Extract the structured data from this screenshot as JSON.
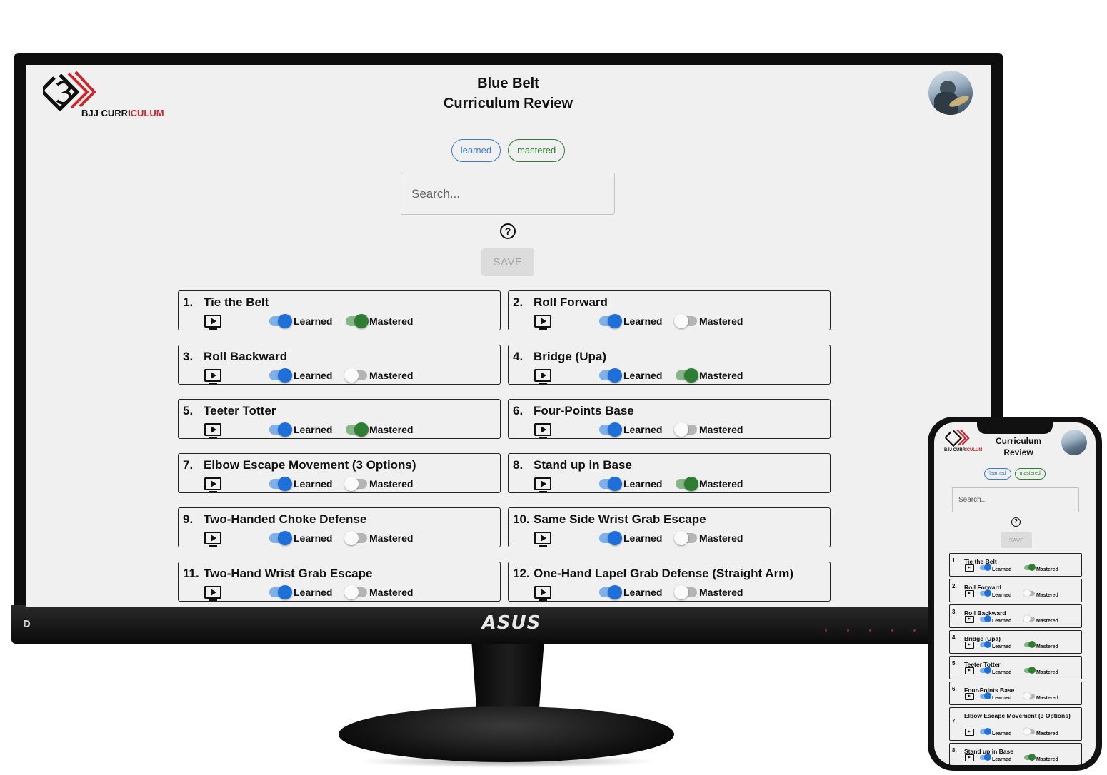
{
  "app": {
    "logo_text_dark": "BJJ CURRI",
    "logo_text_red": "CULUM",
    "title_line1": "Blue Belt",
    "title_line2": "Curriculum Review",
    "avatar_icon": "user-avatar-photo"
  },
  "filters": {
    "learned_label": "learned",
    "mastered_label": "mastered"
  },
  "search": {
    "placeholder": "Search..."
  },
  "help_glyph": "?",
  "save_label": "SAVE",
  "toggle_labels": {
    "learned": "Learned",
    "mastered": "Mastered"
  },
  "colors": {
    "learned_blue": "#1f6fd8",
    "mastered_green": "#2e7d32",
    "brand_red": "#c8282d"
  },
  "techniques": [
    {
      "num": "1.",
      "title": "Tie the Belt",
      "learned": true,
      "mastered": true
    },
    {
      "num": "2.",
      "title": "Roll Forward",
      "learned": true,
      "mastered": false
    },
    {
      "num": "3.",
      "title": "Roll Backward",
      "learned": true,
      "mastered": false
    },
    {
      "num": "4.",
      "title": "Bridge (Upa)",
      "learned": true,
      "mastered": true
    },
    {
      "num": "5.",
      "title": "Teeter Totter",
      "learned": true,
      "mastered": true
    },
    {
      "num": "6.",
      "title": "Four-Points Base",
      "learned": true,
      "mastered": false
    },
    {
      "num": "7.",
      "title": "Elbow Escape Movement (3 Options)",
      "learned": true,
      "mastered": false
    },
    {
      "num": "8.",
      "title": "Stand up in Base",
      "learned": true,
      "mastered": true
    },
    {
      "num": "9.",
      "title": "Two-Handed Choke Defense",
      "learned": true,
      "mastered": false
    },
    {
      "num": "10.",
      "title": "Same Side Wrist Grab Escape",
      "learned": true,
      "mastered": false
    },
    {
      "num": "11.",
      "title": "Two-Hand Wrist Grab Escape",
      "learned": true,
      "mastered": false
    },
    {
      "num": "12.",
      "title": "One-Hand Lapel Grab Defense (Straight Arm)",
      "learned": true,
      "mastered": false
    }
  ],
  "mobile": {
    "title_line1": "Curriculum",
    "title_line2": "Review",
    "techniques": [
      {
        "num": "1.",
        "title": "Tie the Belt",
        "mastered": true
      },
      {
        "num": "2.",
        "title": "Roll Forward",
        "mastered": false
      },
      {
        "num": "3.",
        "title": "Roll Backward",
        "mastered": false
      },
      {
        "num": "4.",
        "title": "Bridge (Upa)",
        "mastered": true
      },
      {
        "num": "5.",
        "title": "Teeter Totter",
        "mastered": true
      },
      {
        "num": "6.",
        "title": "Four-Points Base",
        "mastered": false
      },
      {
        "num": "7.",
        "title": "Elbow Escape Movement (3 Options)",
        "mastered": false
      },
      {
        "num": "8.",
        "title": "Stand up in Base",
        "mastered": true
      }
    ]
  },
  "device": {
    "monitor_brand": "ASUS",
    "port_badge": "D"
  }
}
